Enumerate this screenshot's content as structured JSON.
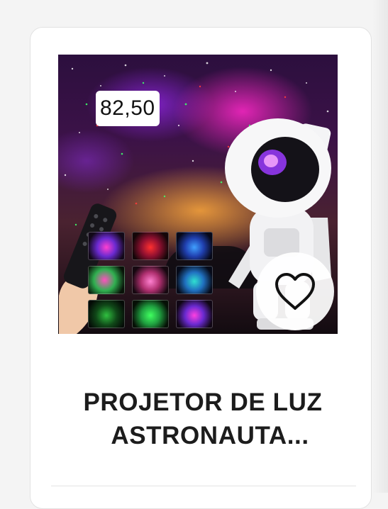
{
  "product": {
    "price": "82,50",
    "title_line1": "PROJETOR DE LUZ",
    "title_line2": "ASTRONAUTA...",
    "favorite_icon": "heart-outline-icon",
    "image_description_icon": "astronaut-projector-image"
  },
  "colors": {
    "card_background": "#ffffff",
    "title_text": "#1c1c1c",
    "badge_background": "#ffffff"
  }
}
